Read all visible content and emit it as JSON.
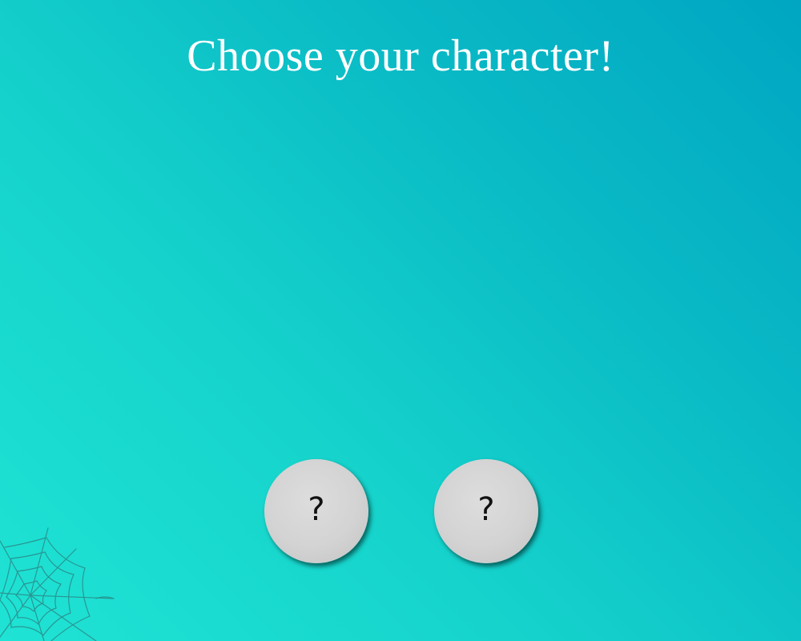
{
  "header": {
    "title": "Choose your character!"
  },
  "characters": [
    {
      "label": "?"
    },
    {
      "label": "?"
    }
  ],
  "decoration": {
    "corner_icon": "spider-web-icon"
  },
  "colors": {
    "background_start": "#1fe3d4",
    "background_end": "#00a6c2",
    "button_fill": "#d3d3d3",
    "title_text": "#ffffff"
  }
}
